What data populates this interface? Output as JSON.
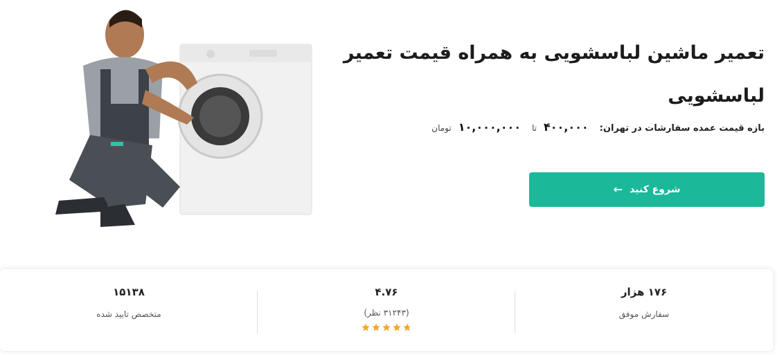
{
  "hero": {
    "title": "تعمیر ماشین لباسشویی به همراه قیمت تعمیر لباسشویی",
    "price_label": "بازه قیمت عمده سفارشات در تهران:",
    "price_min": "۴۰۰,۰۰۰",
    "price_to": "تا",
    "price_max": "۱۰,۰۰۰,۰۰۰",
    "price_unit": "تومان",
    "cta_label": "شروع کنید",
    "cta_icon": "arrow-left-icon"
  },
  "colors": {
    "accent": "#1bb89a",
    "star": "#f4a62a"
  },
  "stats": {
    "orders_value": "۱۷۶ هزار",
    "orders_label": "سفارش موفق",
    "rating_value": "۴.۷۶",
    "rating_count": "(۳۱۲۴۳ نظر)",
    "rating_stars": 4.76,
    "experts_value": "۱۵۱۳۸",
    "experts_label": "متخصص تایید شده"
  }
}
